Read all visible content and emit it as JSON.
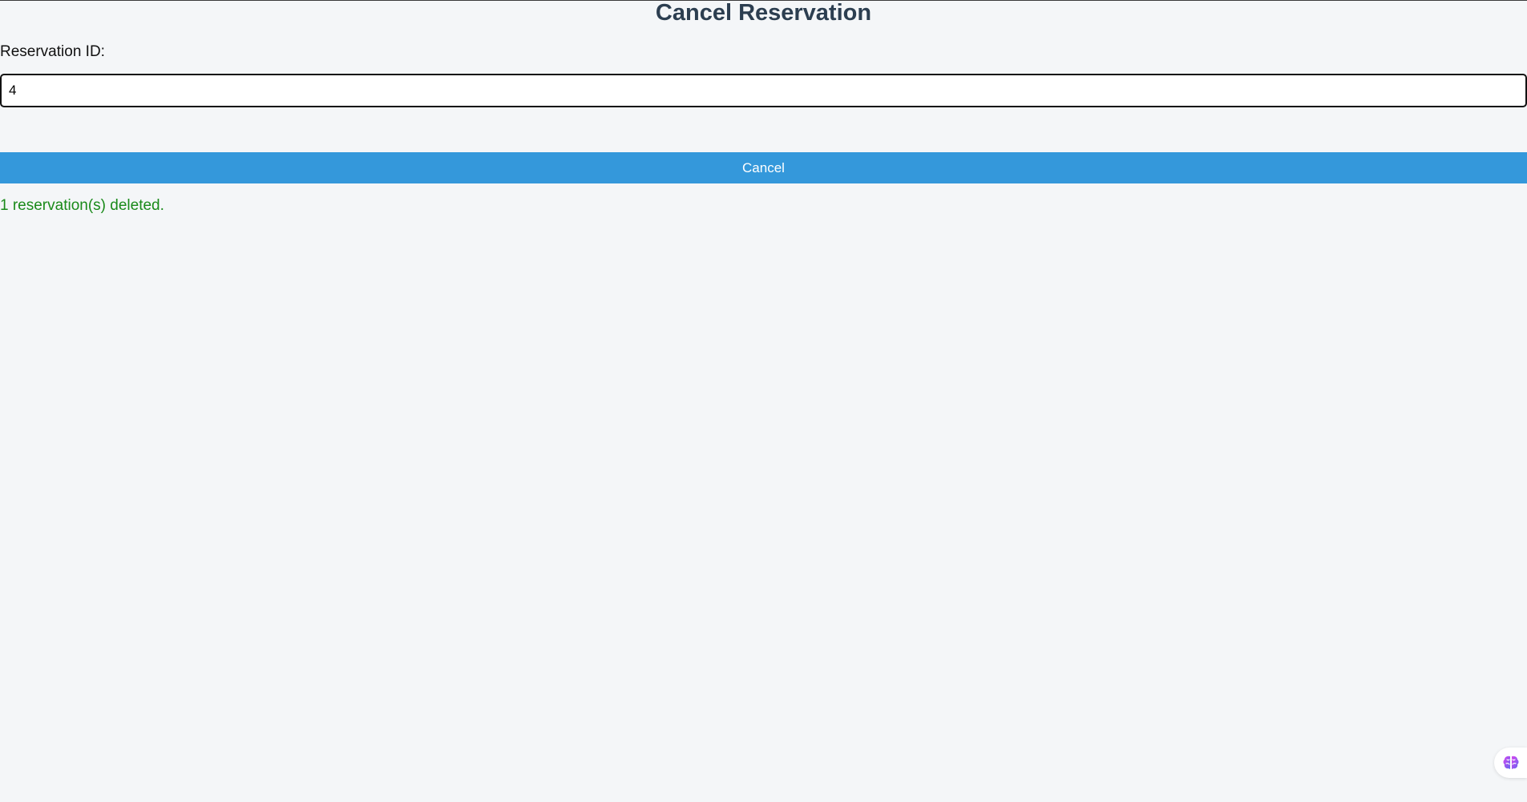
{
  "page": {
    "title": "Cancel Reservation"
  },
  "form": {
    "reservation_id_label": "Reservation ID:",
    "reservation_id_value": "4",
    "cancel_label": "Cancel"
  },
  "status": {
    "message": "1 reservation(s) deleted."
  },
  "widget": {
    "icon": "brain-icon"
  },
  "colors": {
    "background": "#f4f6f8",
    "title": "#2c3e50",
    "button": "#3498db",
    "success": "#1a8a1a"
  }
}
